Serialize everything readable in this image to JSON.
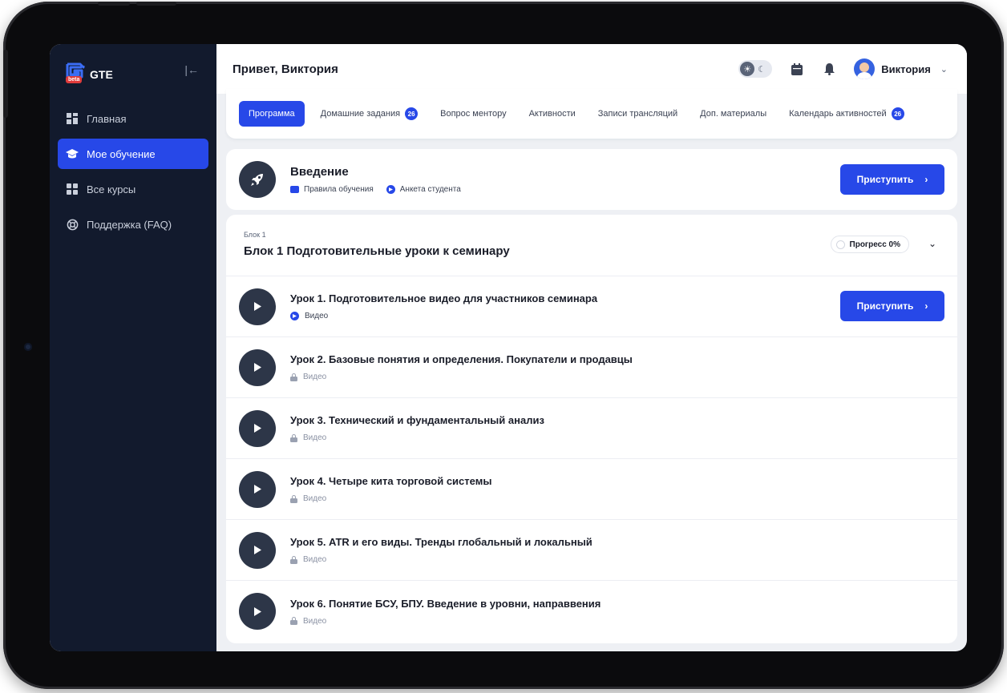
{
  "app": {
    "brand": "GTE",
    "beta_label": "beta"
  },
  "sidebar": {
    "items": [
      {
        "label": "Главная",
        "icon": "grid-icon",
        "active": false
      },
      {
        "label": "Мое обучение",
        "icon": "graduation-cap-icon",
        "active": true
      },
      {
        "label": "Все курсы",
        "icon": "grid-icon",
        "active": false
      },
      {
        "label": "Поддержка (FAQ)",
        "icon": "lifebuoy-icon",
        "active": false
      }
    ]
  },
  "header": {
    "greeting": "Привет, Виктория",
    "user_name": "Виктория"
  },
  "tabs": [
    {
      "label": "Программа",
      "badge": null,
      "active": true
    },
    {
      "label": "Домашние задания",
      "badge": "26",
      "active": false
    },
    {
      "label": "Вопрос ментору",
      "badge": null,
      "active": false
    },
    {
      "label": "Активности",
      "badge": null,
      "active": false
    },
    {
      "label": "Записи трансляций",
      "badge": null,
      "active": false
    },
    {
      "label": "Доп. материалы",
      "badge": null,
      "active": false
    },
    {
      "label": "Календарь активностей",
      "badge": "26",
      "active": false
    }
  ],
  "intro": {
    "title": "Введение",
    "links": [
      "Правила обучения",
      "Анкета студента"
    ],
    "button": "Приступить"
  },
  "block": {
    "small_label": "Блок 1",
    "title": "Блок 1 Подготовительные уроки к семинару",
    "progress_label": "Прогресс 0%",
    "progress_value": 0
  },
  "lessons": [
    {
      "title": "Урок 1. Подготовительное видео для участников семинара",
      "type": "Видео",
      "locked": false,
      "button": "Приступить"
    },
    {
      "title": "Урок 2. Базовые понятия и определения. Покупатели и продавцы",
      "type": "Видео",
      "locked": true
    },
    {
      "title": "Урок 3. Технический и фундаментальный анализ",
      "type": "Видео",
      "locked": true
    },
    {
      "title": "Урок 4. Четыре кита торговой системы",
      "type": "Видео",
      "locked": true
    },
    {
      "title": "Урок 5. ATR и его виды. Тренды глобальный и локальный",
      "type": "Видео",
      "locked": true
    },
    {
      "title": "Урок 6. Понятие БСУ, БПУ. Введение в уровни, направвения",
      "type": "Видео",
      "locked": true
    }
  ],
  "colors": {
    "accent": "#2748e8",
    "sidebar_bg": "#121a2d",
    "badge_red": "#e03b3b"
  }
}
